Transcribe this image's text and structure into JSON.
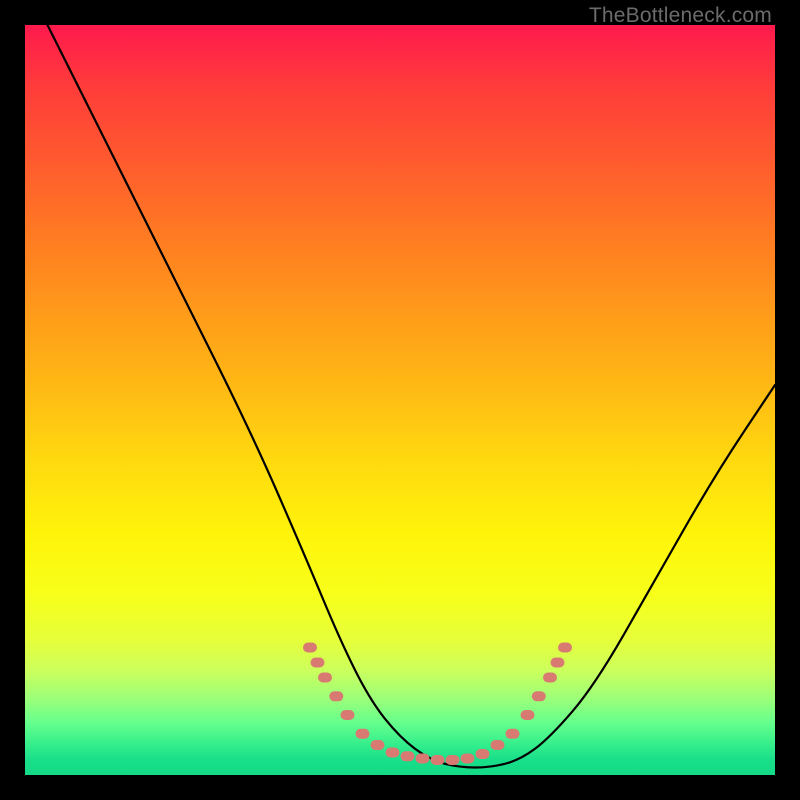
{
  "watermark": {
    "text": "TheBottleneck.com"
  },
  "chart_data": {
    "type": "line",
    "title": "",
    "xlabel": "",
    "ylabel": "",
    "xlim": [
      0,
      100
    ],
    "ylim": [
      0,
      100
    ],
    "grid": false,
    "series": [
      {
        "name": "curve",
        "color": "#000000",
        "x": [
          3,
          10,
          20,
          30,
          37,
          42,
          46,
          50,
          54,
          58,
          62,
          66,
          70,
          76,
          84,
          92,
          100
        ],
        "y": [
          100,
          86,
          66,
          46,
          30,
          18,
          10,
          5,
          2,
          1,
          1,
          2,
          5,
          12,
          26,
          40,
          52
        ]
      }
    ],
    "markers": [
      {
        "name": "bottom-dots",
        "color": "#d97a72",
        "shape": "rounded-rect",
        "points_xy": [
          [
            38,
            17
          ],
          [
            39,
            15
          ],
          [
            40,
            13
          ],
          [
            41.5,
            10.5
          ],
          [
            43,
            8
          ],
          [
            45,
            5.5
          ],
          [
            47,
            4
          ],
          [
            49,
            3
          ],
          [
            51,
            2.5
          ],
          [
            53,
            2.2
          ],
          [
            55,
            2
          ],
          [
            57,
            2
          ],
          [
            59,
            2.2
          ],
          [
            61,
            2.8
          ],
          [
            63,
            4
          ],
          [
            65,
            5.5
          ],
          [
            67,
            8
          ],
          [
            68.5,
            10.5
          ],
          [
            70,
            13
          ],
          [
            71,
            15
          ],
          [
            72,
            17
          ]
        ]
      }
    ]
  }
}
